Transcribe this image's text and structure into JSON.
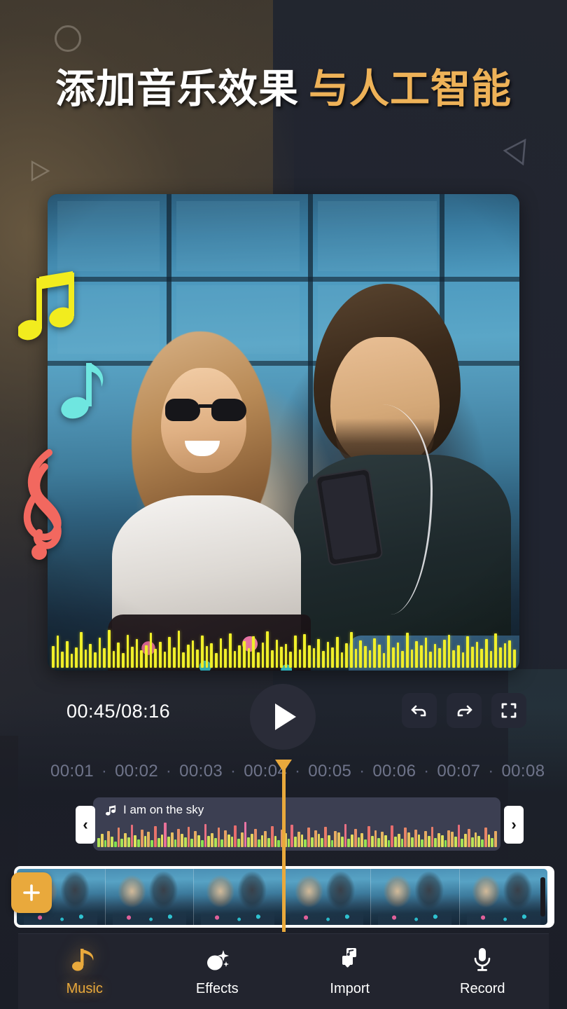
{
  "headline": {
    "text_white": "添加音乐效果",
    "text_gold": "与人工智能",
    "color_white": "#ffffff",
    "color_gold": "#eeb258"
  },
  "decorations": {
    "circle": "circle-outline",
    "triangle_left": "triangle-right-outline",
    "triangle_right": "triangle-left-outline",
    "notes": [
      {
        "name": "beamed-note",
        "color": "#f2ec1e"
      },
      {
        "name": "eighth-note",
        "color": "#6fe6e0"
      },
      {
        "name": "treble-clef",
        "color": "#f2685f"
      }
    ]
  },
  "preview": {
    "waveform_color": "#f0ef2a",
    "waveform_bars": [
      22,
      38,
      14,
      30,
      11,
      20,
      44,
      17,
      26,
      13,
      35,
      19,
      47,
      15,
      28,
      12,
      40,
      21,
      33,
      16,
      24,
      43,
      18,
      29,
      14,
      36,
      20,
      46,
      13,
      25,
      31,
      17,
      39,
      22,
      27,
      12,
      34,
      18,
      42,
      15,
      23,
      30,
      19,
      37,
      13,
      28,
      45,
      16,
      32,
      21,
      26,
      14,
      38,
      17,
      41,
      24,
      19,
      33,
      15,
      29,
      20,
      36,
      13,
      27,
      44,
      18,
      31,
      22,
      16,
      34,
      25,
      12,
      39,
      20,
      28,
      15,
      43,
      17,
      30,
      23,
      35,
      14,
      26,
      19,
      32,
      40,
      16,
      24,
      13,
      37,
      21,
      29,
      18,
      33,
      15,
      42,
      20,
      27,
      31,
      17
    ]
  },
  "player": {
    "current_time": "00:45",
    "total_time": "08:16",
    "time_separator": "/",
    "play_button": "play-icon",
    "undo_button": "undo-icon",
    "redo_button": "redo-icon",
    "fullscreen_button": "fullscreen-icon"
  },
  "timeline": {
    "ticks": [
      "00:01",
      "00:02",
      "00:03",
      "00:04",
      "00:05",
      "00:06",
      "00:07",
      "00:08"
    ],
    "separator": "·",
    "playhead_color": "#e9a93c"
  },
  "audio_track": {
    "title": "I am on the sky",
    "icon": "music-note-icon",
    "handle_left": "‹",
    "handle_right": "›",
    "clip_color": "#3c3f52",
    "wave_heights": [
      12,
      18,
      9,
      22,
      14,
      8,
      26,
      11,
      19,
      13,
      30,
      16,
      10,
      24,
      15,
      21,
      9,
      28,
      12,
      17,
      33,
      14,
      20,
      10,
      25,
      18,
      13,
      27,
      11,
      22,
      16,
      9,
      31,
      15,
      19,
      12,
      26,
      10,
      23,
      17,
      14,
      29,
      11,
      20,
      34,
      13,
      18,
      25,
      10,
      16,
      22,
      12,
      28,
      15,
      9,
      24,
      19,
      11,
      30,
      14,
      21,
      17,
      10,
      26,
      13,
      23,
      18,
      12,
      27,
      16,
      9,
      22,
      20,
      14,
      31,
      11,
      17,
      25,
      13,
      19,
      10,
      28,
      15,
      23,
      12,
      21,
      16,
      9,
      29,
      14,
      18,
      11,
      26,
      20,
      13,
      24,
      17,
      10,
      22,
      15,
      27,
      12,
      19,
      16,
      9,
      23,
      21,
      14,
      30,
      11,
      18,
      25,
      13,
      20,
      15,
      10,
      26,
      17,
      12,
      22
    ]
  },
  "filmstrip": {
    "thumbnail_count": 6,
    "add_button": "add-icon",
    "add_button_color": "#e9a93c"
  },
  "bottom_nav": {
    "items": [
      {
        "label": "Music",
        "icon": "music-note-icon",
        "active": true
      },
      {
        "label": "Effects",
        "icon": "sparkle-icon",
        "active": false
      },
      {
        "label": "Import",
        "icon": "import-icon",
        "active": false
      },
      {
        "label": "Record",
        "icon": "microphone-icon",
        "active": false
      }
    ],
    "active_color": "#e9a93c"
  }
}
